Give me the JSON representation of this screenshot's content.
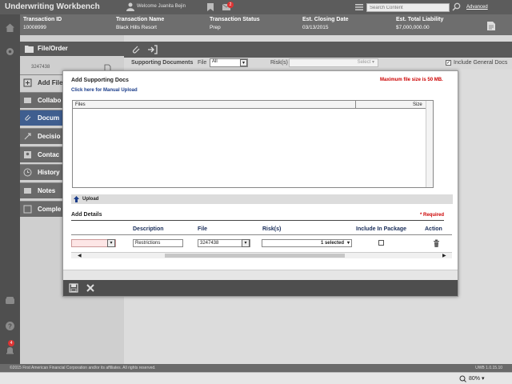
{
  "app": {
    "title": "Underwriting Workbench",
    "welcome": "Welcome Juanita Bejin",
    "mail_count": "2",
    "search_placeholder": "Search Content",
    "advanced": "Advanced"
  },
  "transaction": {
    "id_label": "Transaction ID",
    "id_value": "10008999",
    "name_label": "Transaction Name",
    "name_value": "Black Hills Resort",
    "status_label": "Transaction Status",
    "status_value": "Prep",
    "closing_label": "Est. Closing Date",
    "closing_value": "03/13/2015",
    "liability_label": "Est. Total Liability",
    "liability_value": "$7,000,000.00"
  },
  "nav": {
    "header": "File/Order",
    "file_id": "3247438",
    "items": [
      {
        "label": "Add File"
      },
      {
        "label": "Collabo"
      },
      {
        "label": "Docum"
      },
      {
        "label": "Decisio"
      },
      {
        "label": "Contac"
      },
      {
        "label": "History"
      },
      {
        "label": "Notes"
      },
      {
        "label": "Comple"
      }
    ]
  },
  "rail": {
    "alert_count": "4"
  },
  "docs_bar": {
    "title": "Supporting Documents",
    "file_label": "File",
    "file_value": "All",
    "risk_label": "Risk(s)",
    "risk_value": "Select",
    "include_label": "Include General Docs",
    "include_checked": "✓"
  },
  "modal": {
    "title": "Add Supporting Docs",
    "max_size": "Maximum file size is 50 MB.",
    "manual_upload": "Click here for Manual Upload",
    "files_col": "Files",
    "size_col": "Size",
    "upload": "Upload",
    "add_details": "Add Details",
    "required": "* Required",
    "columns": {
      "description": "Description",
      "file": "File",
      "risks": "Risk(s)",
      "include": "Include In Package",
      "action": "Action"
    },
    "row": {
      "description": "Restrictions",
      "file": "3247438",
      "risks": "1 selected"
    }
  },
  "footer": {
    "copyright": "©2015 First American Financial Corporation and/or its affiliates. All rights reserved.",
    "version": "UWB 1.0.15.10"
  },
  "status": {
    "zoom": "80%"
  }
}
